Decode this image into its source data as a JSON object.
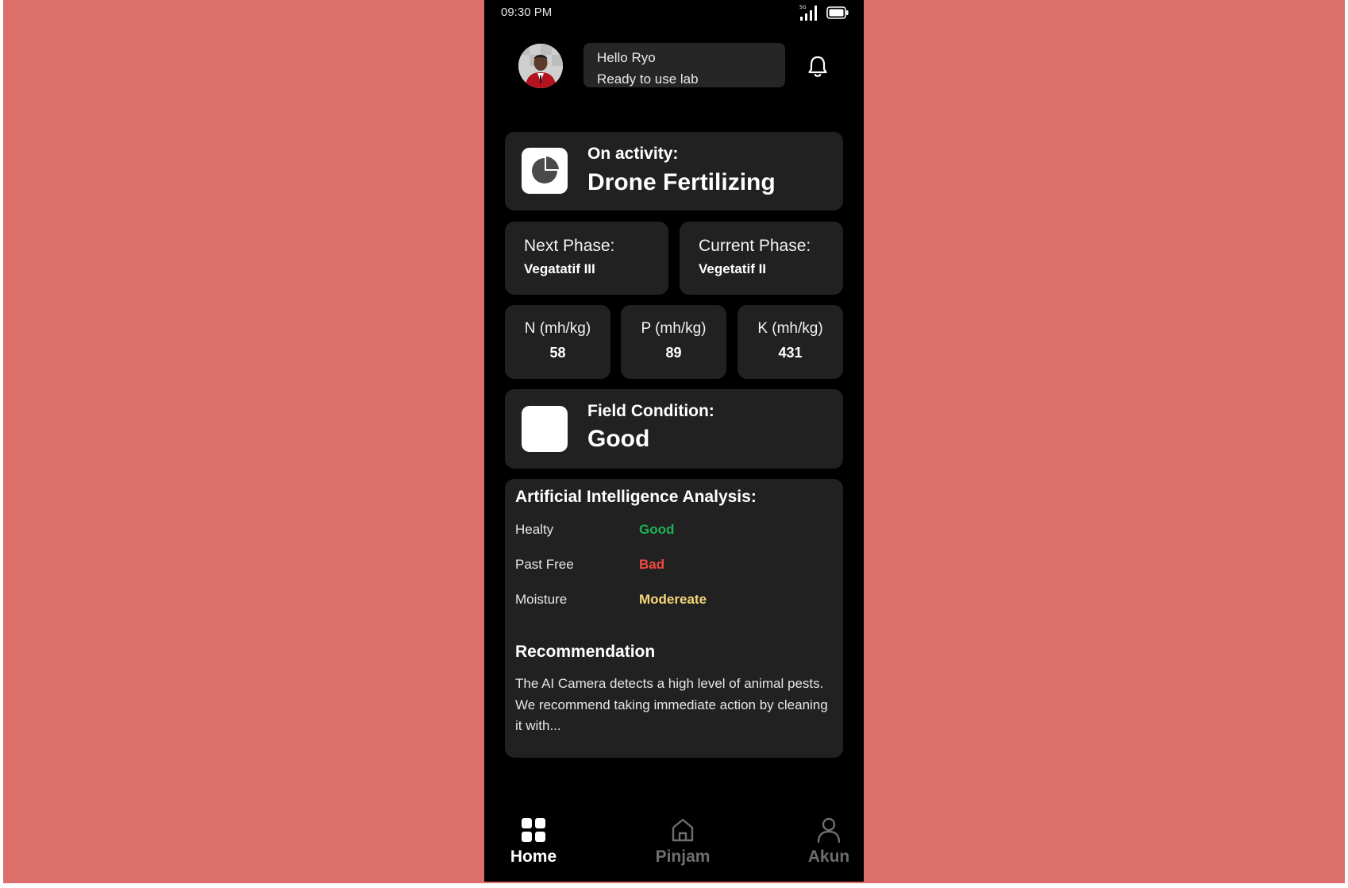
{
  "status_bar": {
    "time": "09:30 PM",
    "signal_icon": "signal-5g-icon",
    "battery_icon": "battery-icon"
  },
  "header": {
    "greeting_line1": "Hello Ryo",
    "greeting_line2": "Ready to use lab",
    "avatar": "user-avatar",
    "notification_icon": "bell-icon"
  },
  "activity": {
    "label": "On activity:",
    "value": "Drone Fertilizing",
    "icon": "pie-chart-icon"
  },
  "phases": {
    "next_label": "Next Phase:",
    "next_value": "Vegatatif III",
    "current_label": "Current Phase:",
    "current_value": "Vegetatif II"
  },
  "nutrients": [
    {
      "label": "N (mh/kg)",
      "value": "58"
    },
    {
      "label": "P (mh/kg)",
      "value": "89"
    },
    {
      "label": "K (mh/kg)",
      "value": "431"
    }
  ],
  "field_condition": {
    "label": "Field Condition:",
    "value": "Good"
  },
  "ai_analysis": {
    "title": "Artificial Intelligence Analysis:",
    "rows": [
      {
        "label": "Healty",
        "value": "Good",
        "color": "#1fb254"
      },
      {
        "label": "Past Free",
        "value": "Bad",
        "color": "#f0493e"
      },
      {
        "label": "Moisture",
        "value": "Modereate",
        "color": "#f5d67a"
      }
    ],
    "recommendation_title": "Recommendation",
    "recommendation_text": "The AI Camera detects a high level of animal pests. We recommend taking immediate action by cleaning it with..."
  },
  "bottom_nav": [
    {
      "label": "Home",
      "icon": "grid-icon",
      "active": true
    },
    {
      "label": "Pinjam",
      "icon": "home-icon",
      "active": false
    },
    {
      "label": "Akun",
      "icon": "user-icon",
      "active": false
    }
  ],
  "colors": {
    "background": "#dc6e6c",
    "phone": "#000000",
    "card": "#212121",
    "nav_inactive": "#6e6e6e"
  }
}
